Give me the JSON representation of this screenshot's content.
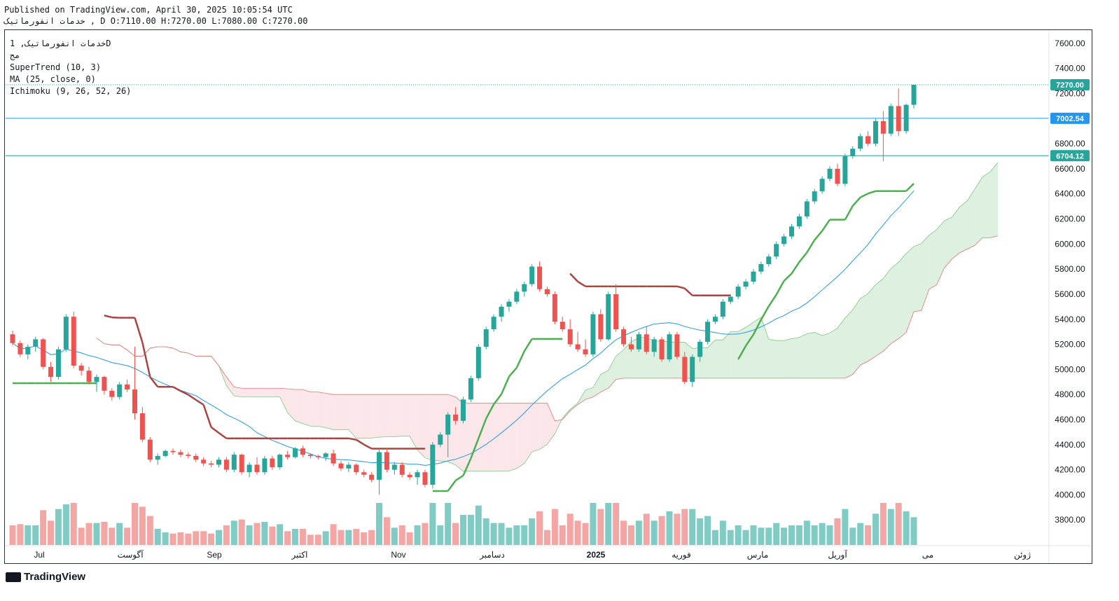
{
  "header": {
    "published": "Published on TradingView.com, April 30, 2025 10:05:54 UTC",
    "ohlc_line": "خدمات انفورماتیک , D O:7110.00 H:7270.00 L:7080.00 C:7270.00"
  },
  "legend": {
    "symbol": "خدمات انفورماتیک, 1D",
    "exchange": "مج",
    "supertrend": "SuperTrend (10, 3)",
    "ma": "MA (25, close, 0)",
    "ichimoku": "Ichimoku (9, 26, 52, 26)"
  },
  "footer": {
    "brand": "TradingView"
  },
  "colors": {
    "up": "#26a69a",
    "down": "#ef5350",
    "supertrend_up": "#4caf50",
    "supertrend_down": "#a94442",
    "ma": "#2196f3",
    "cloud_up": "#c8e6c9",
    "cloud_down": "#f8d7da",
    "line_level": "#2196f3"
  },
  "chart_data": {
    "type": "candlestick",
    "ylim": [
      3600,
      7700
    ],
    "y_ticks": [
      3800,
      4000,
      4200,
      4400,
      4600,
      4800,
      5000,
      5200,
      5400,
      5600,
      5800,
      6000,
      6200,
      6400,
      6600,
      6800,
      7000,
      7200,
      7400,
      7600
    ],
    "x_labels": [
      "Jul",
      "آگوست",
      "Sep",
      "اکتبر",
      "Nov",
      "دسامبر",
      "2025",
      "فوریه",
      "مارس",
      "آوریل",
      "می",
      "ژوئن"
    ],
    "price_labels": [
      {
        "value": 7270.0,
        "text": "7270.00",
        "color": "#26a69a"
      },
      {
        "value": 7002.54,
        "text": "7002.54",
        "color": "#2196f3"
      },
      {
        "value": 6704.12,
        "text": "6704.12",
        "color": "#26a69a"
      }
    ],
    "horizontal_lines": [
      7002.54,
      6704.12
    ],
    "last_close": 7270,
    "candles": [
      [
        5280,
        5310,
        5190,
        5210
      ],
      [
        5210,
        5230,
        5100,
        5120
      ],
      [
        5120,
        5200,
        5080,
        5180
      ],
      [
        5180,
        5260,
        5140,
        5240
      ],
      [
        5240,
        5250,
        5000,
        5020
      ],
      [
        5020,
        5060,
        4900,
        4940
      ],
      [
        4940,
        5180,
        4920,
        5160
      ],
      [
        5160,
        5440,
        5140,
        5420
      ],
      [
        5420,
        5460,
        5010,
        5030
      ],
      [
        5030,
        5050,
        4950,
        4990
      ],
      [
        4990,
        5020,
        4880,
        4900
      ],
      [
        4900,
        4960,
        4820,
        4940
      ],
      [
        4940,
        4950,
        4800,
        4830
      ],
      [
        4830,
        4850,
        4750,
        4780
      ],
      [
        4780,
        4900,
        4760,
        4880
      ],
      [
        4880,
        4920,
        4820,
        4840
      ],
      [
        4840,
        5180,
        4600,
        4650
      ],
      [
        4650,
        4700,
        4420,
        4440
      ],
      [
        4440,
        4460,
        4260,
        4280
      ],
      [
        4280,
        4330,
        4240,
        4310
      ],
      [
        4310,
        4360,
        4300,
        4350
      ],
      [
        4350,
        4370,
        4320,
        4340
      ],
      [
        4340,
        4360,
        4300,
        4320
      ],
      [
        4320,
        4340,
        4290,
        4310
      ],
      [
        4310,
        4330,
        4260,
        4280
      ],
      [
        4280,
        4300,
        4230,
        4250
      ],
      [
        4250,
        4270,
        4220,
        4240
      ],
      [
        4240,
        4300,
        4220,
        4280
      ],
      [
        4280,
        4300,
        4180,
        4200
      ],
      [
        4200,
        4340,
        4180,
        4320
      ],
      [
        4320,
        4330,
        4160,
        4180
      ],
      [
        4180,
        4260,
        4140,
        4240
      ],
      [
        4240,
        4300,
        4160,
        4180
      ],
      [
        4180,
        4310,
        4160,
        4290
      ],
      [
        4290,
        4310,
        4200,
        4220
      ],
      [
        4220,
        4330,
        4200,
        4320
      ],
      [
        4320,
        4350,
        4280,
        4300
      ],
      [
        4300,
        4380,
        4290,
        4370
      ],
      [
        4370,
        4390,
        4300,
        4320
      ],
      [
        4320,
        4330,
        4290,
        4310
      ],
      [
        4310,
        4320,
        4280,
        4300
      ],
      [
        4300,
        4340,
        4270,
        4330
      ],
      [
        4330,
        4360,
        4230,
        4250
      ],
      [
        4250,
        4270,
        4190,
        4210
      ],
      [
        4210,
        4260,
        4180,
        4240
      ],
      [
        4240,
        4250,
        4160,
        4180
      ],
      [
        4180,
        4200,
        4140,
        4160
      ],
      [
        4160,
        4180,
        4100,
        4120
      ],
      [
        4120,
        4360,
        4000,
        4340
      ],
      [
        4340,
        4370,
        4180,
        4200
      ],
      [
        4200,
        4260,
        4160,
        4240
      ],
      [
        4240,
        4260,
        4140,
        4160
      ],
      [
        4160,
        4180,
        4120,
        4140
      ],
      [
        4140,
        4200,
        4080,
        4180
      ],
      [
        4180,
        4200,
        4060,
        4080
      ],
      [
        4080,
        4420,
        4050,
        4400
      ],
      [
        4400,
        4500,
        4380,
        4480
      ],
      [
        4480,
        4660,
        4300,
        4640
      ],
      [
        4640,
        4700,
        4560,
        4590
      ],
      [
        4590,
        4780,
        4570,
        4760
      ],
      [
        4760,
        4950,
        4740,
        4930
      ],
      [
        4930,
        5200,
        4910,
        5180
      ],
      [
        5180,
        5340,
        5160,
        5320
      ],
      [
        5320,
        5440,
        5300,
        5420
      ],
      [
        5420,
        5520,
        5380,
        5500
      ],
      [
        5500,
        5560,
        5460,
        5540
      ],
      [
        5540,
        5640,
        5520,
        5620
      ],
      [
        5620,
        5700,
        5580,
        5680
      ],
      [
        5680,
        5840,
        5660,
        5820
      ],
      [
        5820,
        5860,
        5620,
        5640
      ],
      [
        5640,
        5660,
        5580,
        5600
      ],
      [
        5600,
        5620,
        5360,
        5380
      ],
      [
        5380,
        5420,
        5300,
        5320
      ],
      [
        5320,
        5400,
        5180,
        5200
      ],
      [
        5200,
        5300,
        5140,
        5160
      ],
      [
        5160,
        5240,
        5100,
        5120
      ],
      [
        5120,
        5460,
        5100,
        5440
      ],
      [
        5440,
        5480,
        5220,
        5240
      ],
      [
        5240,
        5620,
        5230,
        5600
      ],
      [
        5600,
        5680,
        5300,
        5320
      ],
      [
        5320,
        5340,
        5180,
        5200
      ],
      [
        5200,
        5260,
        5140,
        5160
      ],
      [
        5160,
        5300,
        5140,
        5280
      ],
      [
        5280,
        5340,
        5120,
        5140
      ],
      [
        5140,
        5260,
        5100,
        5240
      ],
      [
        5240,
        5260,
        5060,
        5080
      ],
      [
        5080,
        5300,
        5060,
        5280
      ],
      [
        5280,
        5300,
        5080,
        5100
      ],
      [
        5100,
        5140,
        4880,
        4900
      ],
      [
        4900,
        5120,
        4860,
        5100
      ],
      [
        5100,
        5240,
        5060,
        5220
      ],
      [
        5220,
        5400,
        5200,
        5380
      ],
      [
        5380,
        5440,
        5360,
        5420
      ],
      [
        5420,
        5560,
        5400,
        5540
      ],
      [
        5540,
        5600,
        5520,
        5580
      ],
      [
        5580,
        5680,
        5560,
        5660
      ],
      [
        5660,
        5720,
        5640,
        5700
      ],
      [
        5700,
        5800,
        5680,
        5780
      ],
      [
        5780,
        5860,
        5760,
        5840
      ],
      [
        5840,
        5920,
        5820,
        5900
      ],
      [
        5900,
        6020,
        5880,
        6000
      ],
      [
        6000,
        6080,
        5980,
        6060
      ],
      [
        6060,
        6160,
        6040,
        6140
      ],
      [
        6140,
        6240,
        6120,
        6220
      ],
      [
        6220,
        6360,
        6200,
        6340
      ],
      [
        6340,
        6440,
        6320,
        6420
      ],
      [
        6420,
        6540,
        6400,
        6520
      ],
      [
        6520,
        6620,
        6500,
        6600
      ],
      [
        6600,
        6640,
        6460,
        6480
      ],
      [
        6480,
        6720,
        6460,
        6700
      ],
      [
        6700,
        6780,
        6680,
        6760
      ],
      [
        6760,
        6880,
        6740,
        6860
      ],
      [
        6860,
        6900,
        6780,
        6800
      ],
      [
        6800,
        7000,
        6780,
        6980
      ],
      [
        6980,
        7060,
        6660,
        6880
      ],
      [
        6880,
        7120,
        6860,
        7100
      ],
      [
        7100,
        7240,
        6860,
        6900
      ],
      [
        6900,
        7120,
        6880,
        7110
      ],
      [
        7110,
        7270,
        7080,
        7270
      ]
    ]
  }
}
